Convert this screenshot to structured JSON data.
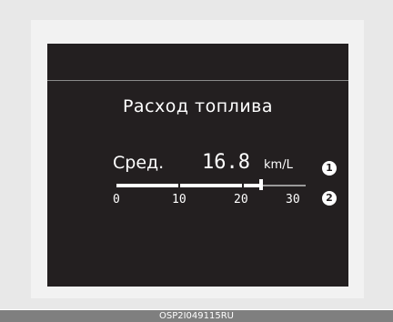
{
  "display": {
    "title": "Расход топлива",
    "average_label": "Сред.",
    "average_value": "16.8",
    "unit": "km/L",
    "gauge": {
      "min": 0,
      "max": 30,
      "current": 16.8,
      "marker_value": 23,
      "scale_labels": [
        "0",
        "10",
        "20",
        "30"
      ]
    }
  },
  "callouts": {
    "first": "1",
    "second": "2"
  },
  "footer": {
    "image_code": "OSP2I049115RU"
  },
  "colors": {
    "screen_background": "#231f20",
    "text": "#ffffff",
    "bezel": "#e8e8e8",
    "code_bar": "#7f7f7f"
  }
}
